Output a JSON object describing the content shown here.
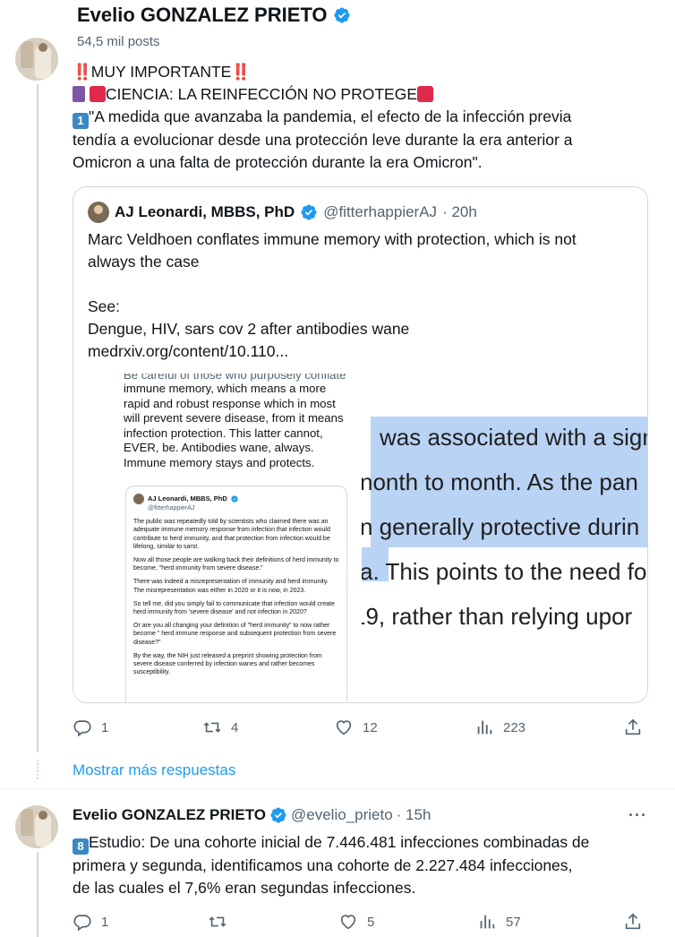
{
  "header": {
    "name": "Evelio GONZALEZ PRIETO",
    "posts_count": "54,5 mil posts"
  },
  "tweet1": {
    "lines": [
      "MUY IMPORTANTE",
      "CIENCIA: LA REINFECCIÓN NO PROTEGE",
      "\"A medida que avanzaba la pandemia, el efecto de la infección previa",
      "tendía a evolucionar desde una protección leve durante la era anterior a",
      "Omicron a una falta de protección durante la era Omicron\"."
    ],
    "emoji_bang": "‼️",
    "emoji_number": "1",
    "quote": {
      "author": "AJ Leonardi, MBBS, PhD",
      "handle": "@fitterhappierAJ",
      "time": "· 20h",
      "text_lines": [
        "Marc Veldhoen conflates immune memory with protection, which is not",
        "always the case"
      ],
      "see": "See:",
      "list_line": "Dengue, HIV, sars cov 2 after antibodies wane",
      "link": "medrxiv.org/content/10.110...",
      "image": {
        "cut_line": "Be careful of those who purposely conflate",
        "left_lines": [
          "immune memory, which means a more",
          "rapid and robust response which in most",
          "will prevent severe disease, from it means",
          "infection protection. This latter cannot,",
          "EVER, be. Antibodies wane, always.",
          "Immune memory stays and protects."
        ],
        "inner_author": "AJ Leonardi, MBBS, PhD",
        "inner_handle": "@fitterhappierAJ",
        "inner_paragraphs": [
          "The public was repeatedly told by scientists who claimed there was an adequate immune memory response from infection that infection would contribute to herd immunity, and that protection from infection would be lifelong, similar to sarst.",
          "Now all those people are walking back their definitions of herd immunity to become, \"herd immunity from severe disease.\"",
          "There was indeed a misrepresentation of immunity and herd immunity. The misrepresentation was either in 2020 or it is now, in 2023.",
          "So tell me, did you simply fail to communicate that infection would create herd immunity from 'severe disease' and not infection in 2020?",
          "Or are you all changing your definition of \"herd immunity\" to now rather become \" herd immune response and subsequent protection from severe disease?\"",
          "By the way, the NIH just released a preprint showing protection from severe disease conferred by infection wanes and rather becomes susceptibility."
        ],
        "right_lines": [
          "was associated with a sign",
          "nonth to month. As the pan",
          "n generally protective durin",
          "a. This points to the need fo",
          "19, rather than relying upor"
        ]
      }
    },
    "stats": {
      "replies": "1",
      "reposts": "4",
      "likes": "12",
      "views": "223"
    }
  },
  "show_more": "Mostrar más respuestas",
  "tweet2": {
    "name": "Evelio GONZALEZ PRIETO",
    "handle": "@evelio_prieto",
    "time": "· 15h",
    "more": "···",
    "emoji_number": "8",
    "lines": [
      "Estudio: De una cohorte inicial de 7.446.481 infecciones combinadas de",
      "primera y segunda, identificamos una cohorte de 2.227.484 infecciones,",
      "de las cuales el 7,6% eran segundas infecciones."
    ],
    "stats": {
      "replies": "1",
      "reposts": "",
      "likes": "5",
      "views": "57"
    }
  },
  "colors": {
    "accent": "#1d9bf0",
    "muted": "#536471",
    "border": "#cfd9de",
    "highlight": "#b9d3f5"
  }
}
